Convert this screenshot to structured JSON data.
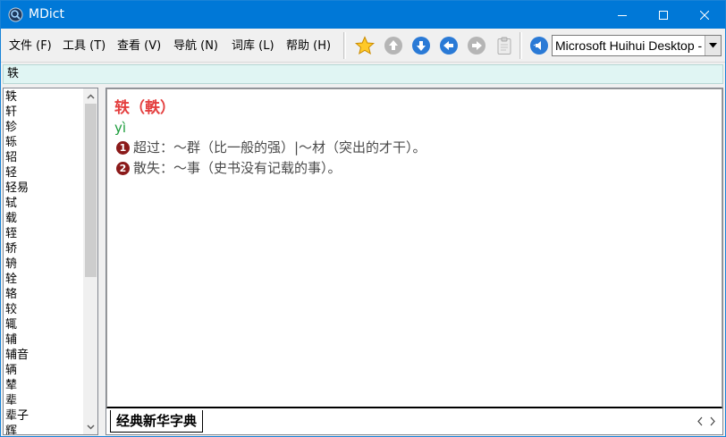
{
  "window": {
    "title": "MDict"
  },
  "menu": {
    "items": [
      {
        "label": "文件 (F)"
      },
      {
        "label": "工具 (T)"
      },
      {
        "label": "查看 (V)"
      },
      {
        "label": "导航 (N)"
      },
      {
        "label": "词库 (L)"
      },
      {
        "label": "帮助 (H)"
      }
    ]
  },
  "toolbar": {
    "icons": [
      "star-icon",
      "up-arrow-icon",
      "down-arrow-icon",
      "back-arrow-icon",
      "forward-arrow-icon",
      "clipboard-icon",
      "speaker-icon"
    ],
    "selected_dictionary": "Microsoft Huihui Desktop -"
  },
  "search": {
    "value": "轶"
  },
  "word_list": {
    "items": [
      "轶",
      "轩",
      "轸",
      "轹",
      "轺",
      "轻",
      "轻易",
      "轼",
      "载",
      "轾",
      "轿",
      "辀",
      "辁",
      "辂",
      "较",
      "辄",
      "辅",
      "辅音",
      "辆",
      "辇",
      "辈",
      "辈子",
      "辉"
    ]
  },
  "entry": {
    "headword": "轶（軼）",
    "pinyin": "yì",
    "senses": [
      {
        "num": "1",
        "text": "超过：～群（比一般的强）|～材（突出的才干）。"
      },
      {
        "num": "2",
        "text": "散失：～事（史书没有记载的事）。"
      }
    ]
  },
  "tabs": {
    "active": "经典新华字典"
  },
  "colors": {
    "titlebar": "#0078d7",
    "headword": "#e44040",
    "pinyin": "#1a9c3a",
    "sense_text": "#4a4a4a",
    "sense_badge": "#8b1a1a",
    "search_bg": "#e0f5f3"
  }
}
